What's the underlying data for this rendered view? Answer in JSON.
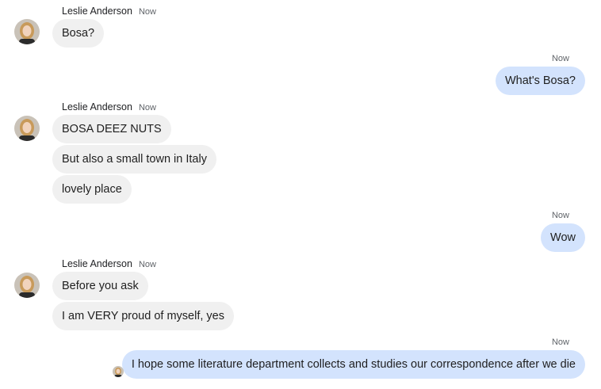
{
  "colors": {
    "incoming_bubble": "#f0f0f0",
    "outgoing_bubble": "#d3e3fd",
    "timestamp": "#5f6368"
  },
  "groups": [
    {
      "sender": "Leslie Anderson",
      "time": "Now",
      "messages": [
        "Bosa?"
      ]
    },
    {
      "outgoing_time": "Now",
      "outgoing": [
        "What's Bosa?"
      ]
    },
    {
      "sender": "Leslie Anderson",
      "time": "Now",
      "messages": [
        "BOSA DEEZ NUTS",
        "But also a small town in Italy",
        "lovely place"
      ]
    },
    {
      "outgoing_time": "Now",
      "outgoing": [
        "Wow"
      ]
    },
    {
      "sender": "Leslie Anderson",
      "time": "Now",
      "messages": [
        "Before you ask",
        "I am VERY proud of myself, yes"
      ]
    },
    {
      "outgoing_time": "Now",
      "outgoing": [
        "I hope some literature department collects and studies our correspondence after we die"
      ],
      "read_receipt": "avatar"
    }
  ]
}
